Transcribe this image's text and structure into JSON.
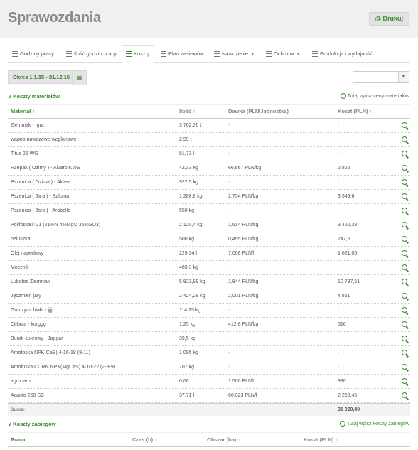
{
  "header": {
    "title": "Sprawozdania",
    "print_label": "Drukuj",
    "print_icon": "print-icon"
  },
  "tabs": [
    {
      "label": "Godziny pracy"
    },
    {
      "label": "Ilość godzin pracy"
    },
    {
      "label": "Koszty",
      "active": true
    },
    {
      "label": "Plan zasiewów"
    },
    {
      "label": "Nawożenie"
    },
    {
      "label": "Ochrona"
    },
    {
      "label": "Produkcja i wydajność"
    }
  ],
  "filters": {
    "period_label": "Okres 1.1.15 - 31.12.15",
    "calendar_icon": "calendar-icon",
    "select_value": ""
  },
  "materials": {
    "section_title": "Koszty materiałów",
    "link": "Tutaj wpisz ceny materiałów",
    "columns": {
      "material": "Materiał",
      "quantity": "Ilość",
      "dose": "Dawka (PLN/Jednostka)",
      "cost": "Koszt (PLN)"
    },
    "rows": [
      {
        "name": "Ziemniak - Igra",
        "qty": "3 702,36 t",
        "dose": "-",
        "cost": "-"
      },
      {
        "name": "wapno nawozowe weglanowe",
        "qty": "2,99 t",
        "dose": "-",
        "cost": "-"
      },
      {
        "name": "Titus 25 WG",
        "qty": "81,73 l",
        "dose": "-",
        "cost": "-"
      },
      {
        "name": "Rzepak ( Ozimy ) - Alvaro KWS",
        "qty": "42,33 kg",
        "dose": "66,667 PLN/kg",
        "cost": "2 822"
      },
      {
        "name": "Pszenica ( Ozima ) - Akteur",
        "qty": "922,5 kg",
        "dose": "-",
        "cost": "-"
      },
      {
        "name": "Pszenica ( Jara ) - Balbina",
        "qty": "1 288,8 kg",
        "dose": "2,754 PLN/kg",
        "cost": "3 549,6"
      },
      {
        "name": "Pszenica ( Jara ) - Arabella",
        "qty": "550 kg",
        "dose": "-",
        "cost": "-"
      },
      {
        "name": "Polifoska® 21 (21%N 4%MgO 35%SO3)",
        "qty": "2 120,4 kg",
        "dose": "1,614 PLN/kg",
        "cost": "3 422,38"
      },
      {
        "name": "peluszka",
        "qty": "500 kg",
        "dose": "0,495 PLN/kg",
        "cost": "247,5"
      },
      {
        "name": "Olej napedowy",
        "qty": "229,34 l",
        "dose": "7,068 PLN/l",
        "cost": "1 621,05"
      },
      {
        "name": "Mocznik",
        "qty": "483,3 kg",
        "dose": "-",
        "cost": "-"
      },
      {
        "name": "Lubofos Ziemniak",
        "qty": "5 823,99 kg",
        "dose": "1,844 PLN/kg",
        "cost": "10 737,51"
      },
      {
        "name": "Jęczmień jary",
        "qty": "2 424,28 kg",
        "dose": "2,001 PLN/kg",
        "cost": "4 851"
      },
      {
        "name": "Gorczyca biała - jjjj",
        "qty": "114,25 kg",
        "dose": "-",
        "cost": "-"
      },
      {
        "name": "Cebula - kurggg",
        "qty": "1,25 kg",
        "dose": "412,8 PLN/kg",
        "cost": "516"
      },
      {
        "name": "Burak cukrowy - Jaggar",
        "qty": "39,5 kg",
        "dose": "-",
        "cost": "-"
      },
      {
        "name": "Amofoska NPK(CaS) 4-16-18 (8-11)",
        "qty": "1 095 kg",
        "dose": "-",
        "cost": "-"
      },
      {
        "name": "Amofoska CORN NPK(MgCaS) 4-10-22 (2-8-9)",
        "qty": "707 kg",
        "dose": "-",
        "cost": "-"
      },
      {
        "name": "agrocarb",
        "qty": "0,66 t",
        "dose": "1 500 PLN/t",
        "cost": "990"
      },
      {
        "name": "Acanto 250 SC",
        "qty": "37,71 l",
        "dose": "60,023 PLN/l",
        "cost": "2 263,45"
      }
    ],
    "sum_label": "Suma:",
    "sum_value": "31 020,49"
  },
  "treatments": {
    "section_title": "Koszty zabiegów",
    "link": "Tutaj wpisz koszty zabiegów",
    "columns": {
      "work": "Praca",
      "time": "Czas (h)",
      "area": "Obszar (ha)",
      "cost": "Koszt (PLN)"
    }
  },
  "colors": {
    "accent": "#3a8a2e",
    "background": "#f0f0f0"
  }
}
